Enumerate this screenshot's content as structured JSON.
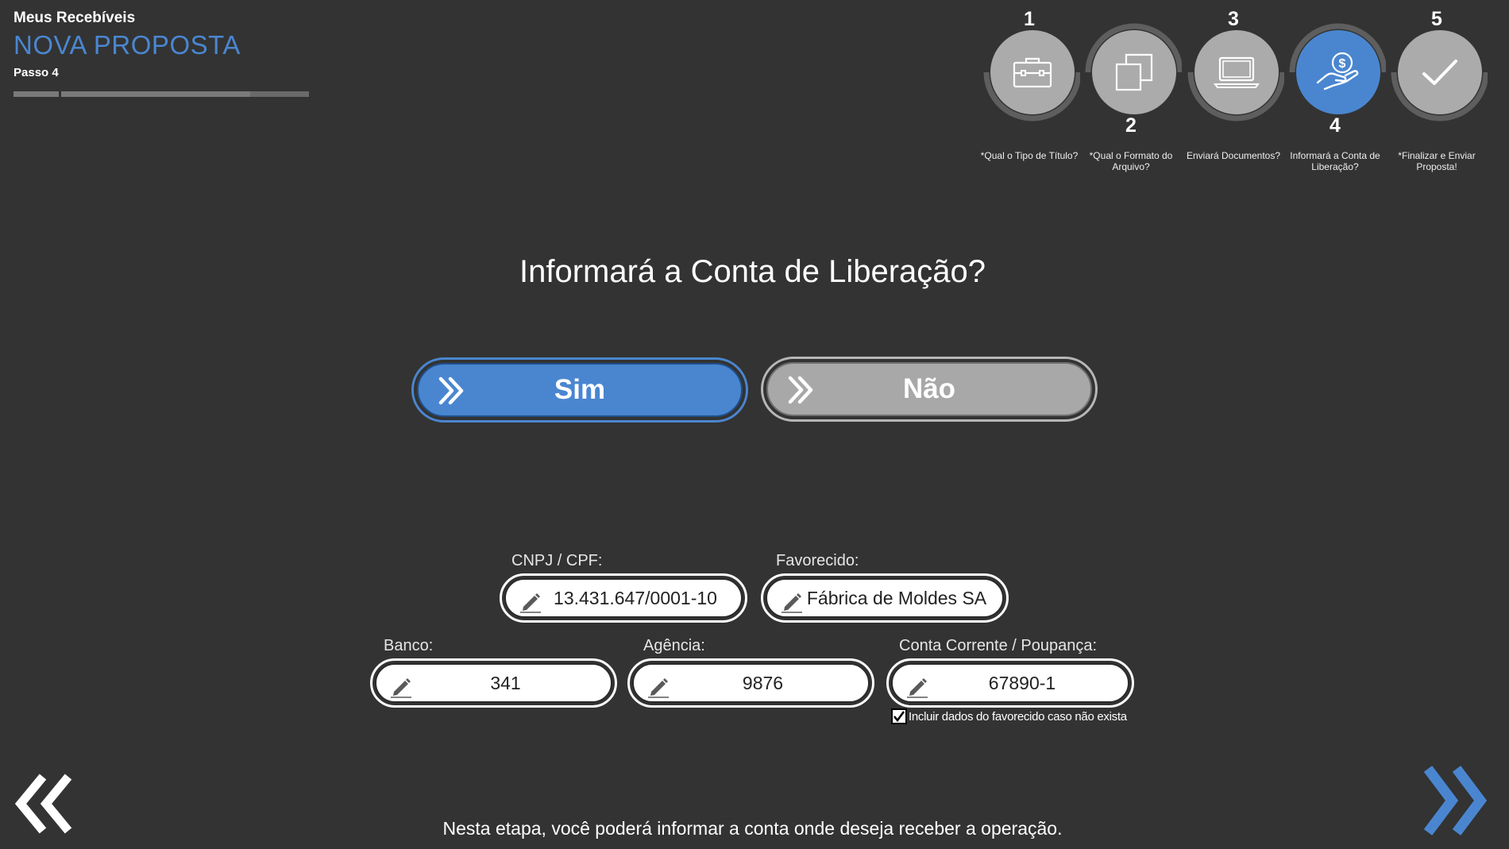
{
  "header": {
    "app_name": "Meus Recebíveis",
    "page_title": "NOVA PROPOSTA",
    "step_label": "Passo 4",
    "progress_fraction": 0.8
  },
  "stepper": {
    "steps": [
      {
        "number": "1",
        "caption": "*Qual o Tipo de Título?",
        "icon": "briefcase-icon",
        "active": false
      },
      {
        "number": "2",
        "caption": "*Qual o Formato do Arquivo?",
        "icon": "copy-icon",
        "active": false
      },
      {
        "number": "3",
        "caption": "Enviará Documentos?",
        "icon": "laptop-icon",
        "active": false
      },
      {
        "number": "4",
        "caption": "Informará a Conta de Liberação?",
        "icon": "hand-money-icon",
        "active": true
      },
      {
        "number": "5",
        "caption": "*Finalizar e Enviar Proposta!",
        "icon": "check-icon",
        "active": false
      }
    ]
  },
  "question": {
    "text": "Informará a Conta de Liberação?",
    "yes_label": "Sim",
    "no_label": "Não"
  },
  "form": {
    "cnpj": {
      "label": "CNPJ / CPF:",
      "value": "13.431.647/0001-10"
    },
    "favorecido": {
      "label": "Favorecido:",
      "value": "Fábrica de Moldes SA"
    },
    "banco": {
      "label": "Banco:",
      "value": "341"
    },
    "agencia": {
      "label": "Agência:",
      "value": "9876"
    },
    "conta": {
      "label": "Conta Corrente / Poupança:",
      "value": "67890-1"
    },
    "include_checkbox": {
      "label": "Incluir dados do favorecido caso não exista",
      "checked": true
    }
  },
  "footer": {
    "text": "Nesta etapa, você poderá informar a conta onde deseja receber a operação."
  },
  "colors": {
    "background": "#333333",
    "accent": "#4a86d0",
    "inactive": "#ababab"
  }
}
